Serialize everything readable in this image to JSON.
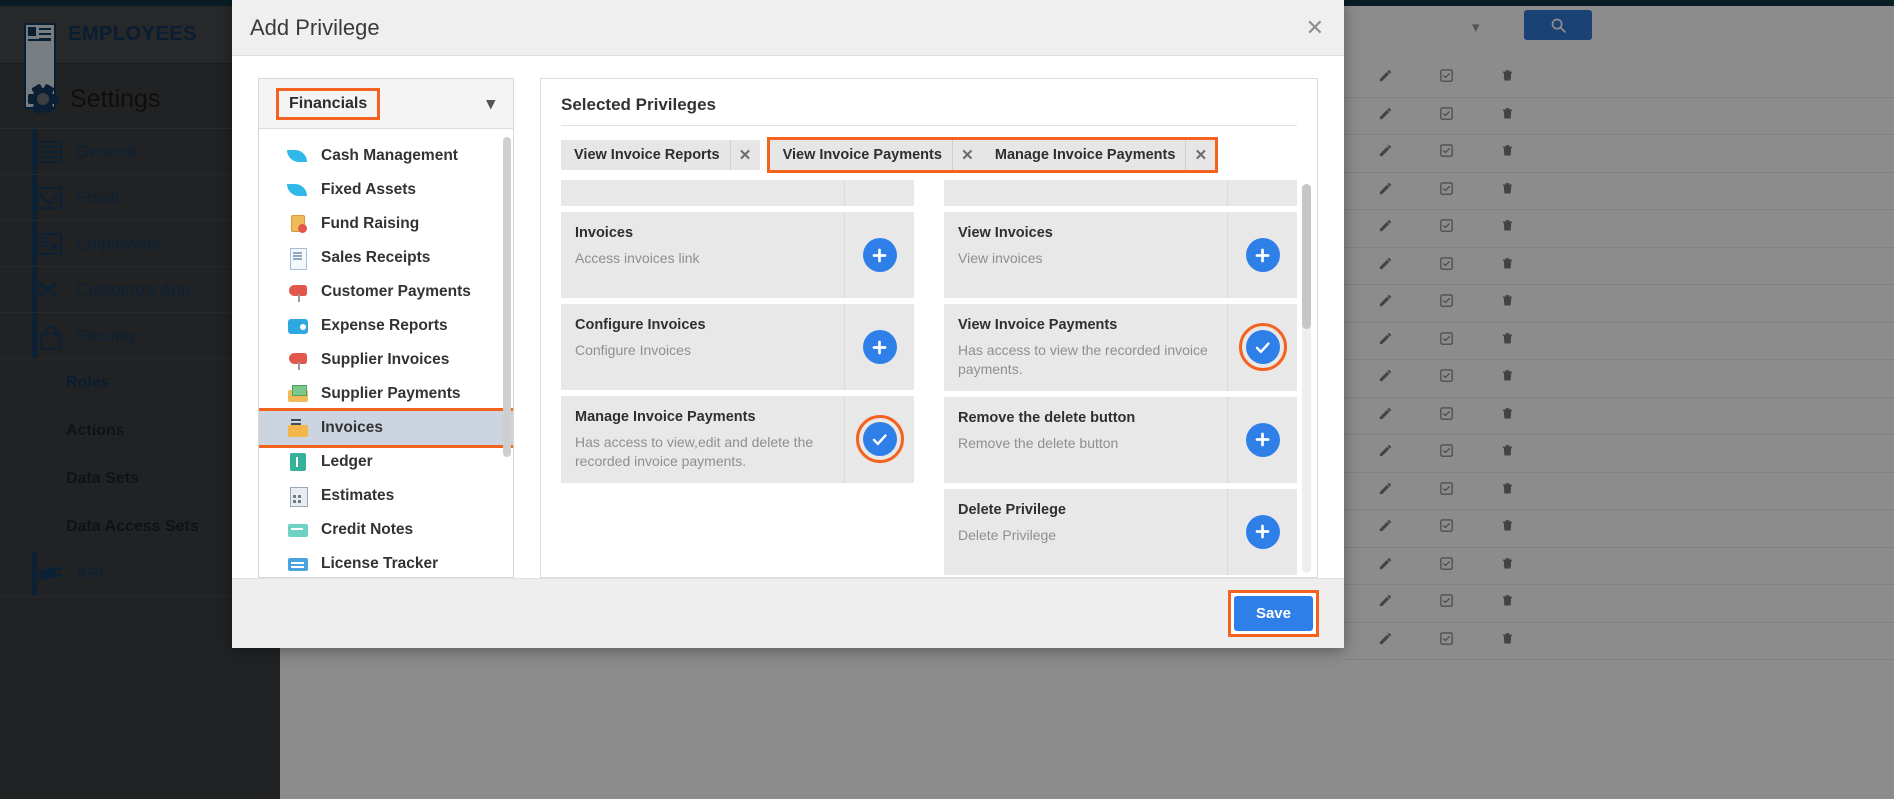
{
  "app": {
    "brand": "EMPLOYEES",
    "brand_icon": "id-card-icon",
    "settings_title": "Settings",
    "nav": [
      {
        "label": "General",
        "icon": "monitor-icon"
      },
      {
        "label": "Email",
        "icon": "envelope-icon"
      },
      {
        "label": "Employees",
        "icon": "employee-card-icon"
      },
      {
        "label": "Customize App",
        "icon": "tools-icon"
      },
      {
        "label": "Security",
        "icon": "lock-icon"
      }
    ],
    "sub_nav": [
      {
        "label": "Roles",
        "active": true
      },
      {
        "label": "Actions",
        "active": false
      },
      {
        "label": "Data Sets",
        "active": false
      },
      {
        "label": "Data Access Sets",
        "active": false
      }
    ],
    "api": {
      "label": "API",
      "icon": "plug-icon"
    },
    "background_table": {
      "search_icon": "search-icon",
      "caret_icon": "chevron-down-icon",
      "row_icons": [
        "pencil-icon",
        "checkbox-icon",
        "trash-icon"
      ],
      "row_count": 16
    }
  },
  "modal": {
    "title": "Add Privilege",
    "close_icon": "close-icon",
    "picker": {
      "selected_category": "Financials",
      "chevron_icon": "chevron-down-icon",
      "items": [
        {
          "label": "Cash Management",
          "icon": "leaf-icon",
          "glyph": "g-leaf"
        },
        {
          "label": "Fixed Assets",
          "icon": "leaf-icon",
          "glyph": "g-leaf"
        },
        {
          "label": "Fund Raising",
          "icon": "coins-icon",
          "glyph": "g-coins"
        },
        {
          "label": "Sales Receipts",
          "icon": "receipt-icon",
          "glyph": "g-receipt"
        },
        {
          "label": "Customer Payments",
          "icon": "mailbox-icon",
          "glyph": "g-mailbox"
        },
        {
          "label": "Expense Reports",
          "icon": "wallet-icon",
          "glyph": "g-wallet"
        },
        {
          "label": "Supplier Invoices",
          "icon": "mailbox-icon",
          "glyph": "g-mailbox"
        },
        {
          "label": "Supplier Payments",
          "icon": "money-envelope-icon",
          "glyph": "g-money"
        },
        {
          "label": "Invoices",
          "icon": "invoice-envelope-icon",
          "glyph": "g-inv",
          "selected": true,
          "highlighted": true
        },
        {
          "label": "Ledger",
          "icon": "ledger-book-icon",
          "glyph": "g-ledger"
        },
        {
          "label": "Estimates",
          "icon": "calculator-icon",
          "glyph": "g-calc"
        },
        {
          "label": "Credit Notes",
          "icon": "credit-note-icon",
          "glyph": "g-note"
        },
        {
          "label": "License Tracker",
          "icon": "license-card-icon",
          "glyph": "g-lic"
        }
      ]
    },
    "selected_privileges": {
      "title": "Selected Privileges",
      "chips": [
        {
          "label": "View Invoice Reports",
          "remove_icon": "close-icon",
          "highlighted": false
        },
        {
          "label": "View Invoice Payments",
          "remove_icon": "close-icon",
          "highlighted": true
        },
        {
          "label": "Manage Invoice Payments",
          "remove_icon": "close-icon",
          "highlighted": true
        }
      ]
    },
    "cards": {
      "left_column": [
        {
          "title": "",
          "desc": "",
          "state": "add",
          "partial": true
        },
        {
          "title": "Invoices",
          "desc": "Access invoices link",
          "state": "add",
          "ring": false
        },
        {
          "title": "Configure Invoices",
          "desc": "Configure Invoices",
          "state": "add",
          "ring": false
        },
        {
          "title": "Manage Invoice Payments",
          "desc": "Has access to view,edit and delete the recorded invoice payments.",
          "state": "check",
          "ring": true
        }
      ],
      "right_column": [
        {
          "title": "",
          "desc": "",
          "state": "add",
          "partial": true
        },
        {
          "title": "View Invoices",
          "desc": "View invoices",
          "state": "add",
          "ring": false
        },
        {
          "title": "View Invoice Payments",
          "desc": "Has access to view the recorded invoice payments.",
          "state": "check",
          "ring": true
        },
        {
          "title": "Remove the delete button",
          "desc": "Remove the delete button",
          "state": "add",
          "ring": false
        },
        {
          "title": "Delete Privilege",
          "desc": "Delete Privilege",
          "state": "add",
          "ring": false
        }
      ],
      "add_icon": "plus-icon",
      "check_icon": "check-icon"
    },
    "footer": {
      "save_label": "Save"
    }
  },
  "colors": {
    "accent_orange": "#f4621f",
    "accent_blue": "#2f7fe8",
    "sidebar_bg": "#3b3f42",
    "nav_text": "#163c63"
  }
}
